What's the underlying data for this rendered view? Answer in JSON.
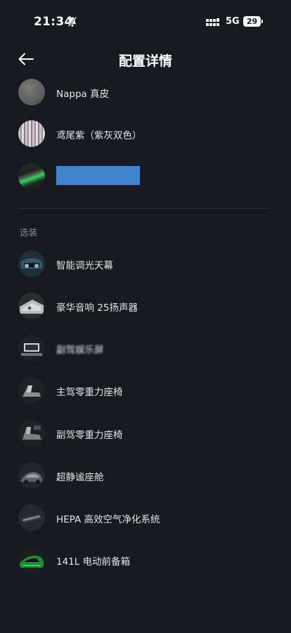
{
  "status_bar": {
    "time": "21:34",
    "network": "5G",
    "battery": "29"
  },
  "header": {
    "title": "配置详情"
  },
  "config_items": [
    {
      "label": "Nappa 真皮",
      "icon": "nappa-leather-swatch"
    },
    {
      "label": "鸢尾紫（紫灰双色）",
      "icon": "iris-purple-swatch"
    },
    {
      "label": "",
      "icon": "exterior-color-swatch",
      "redacted": true
    }
  ],
  "options_section": {
    "title": "选装",
    "items": [
      {
        "label": "智能调光天幕",
        "icon": "smart-dimming-sunroof-thumb"
      },
      {
        "label": "豪华音响 25扬声器",
        "icon": "premium-audio-thumb"
      },
      {
        "label": "副驾娱乐屏",
        "icon": "passenger-screen-thumb",
        "blurred": true
      },
      {
        "label": "主驾零重力座椅",
        "icon": "driver-seat-thumb"
      },
      {
        "label": "副驾零重力座椅",
        "icon": "passenger-seat-thumb"
      },
      {
        "label": "超静谧座舱",
        "icon": "quiet-cabin-thumb"
      },
      {
        "label": "HEPA 高效空气净化系统",
        "icon": "hepa-filter-thumb"
      },
      {
        "label": "141L 电动前备箱",
        "icon": "front-trunk-thumb"
      }
    ]
  },
  "colors": {
    "background": "#17191e",
    "text": "#e3e4e6",
    "muted": "#8a8d93",
    "redaction": "#3f84cc"
  }
}
